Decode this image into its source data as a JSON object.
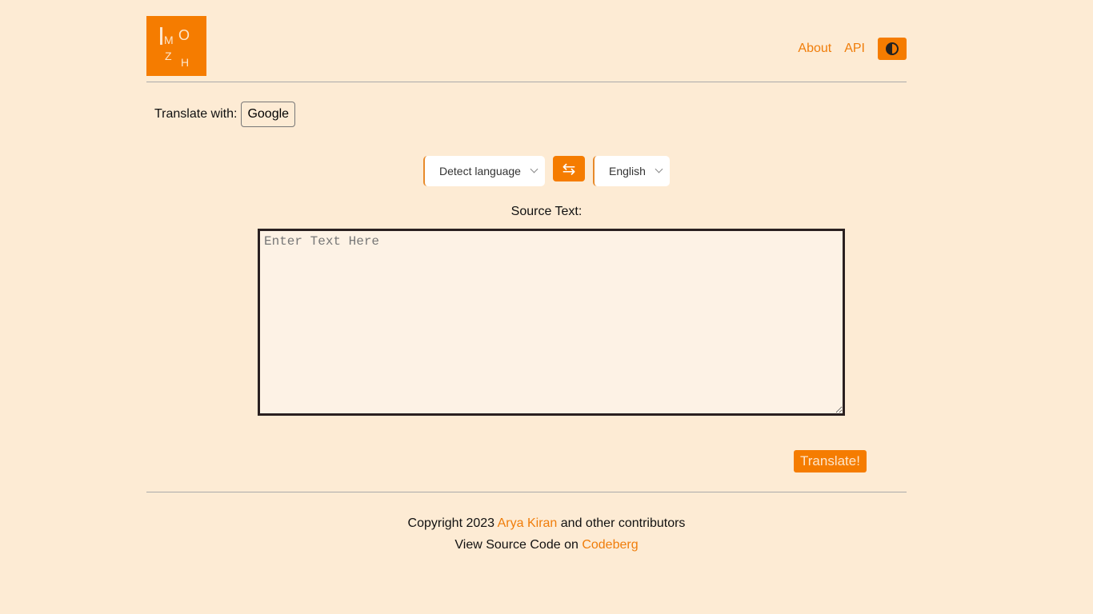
{
  "logo": {
    "letters": [
      "M",
      "O",
      "Z",
      "H"
    ]
  },
  "nav": {
    "about": "About",
    "api": "API"
  },
  "engine": {
    "label": "Translate with:",
    "value": "Google"
  },
  "source_lang": "Detect language",
  "target_lang": "English",
  "source": {
    "label": "Source Text:",
    "placeholder": "Enter Text Here"
  },
  "translate_label": "Translate!",
  "footer": {
    "copy_pre": "Copyright 2023",
    "author": "Arya Kiran",
    "copy_post": "and other contributors",
    "src_pre": "View Source Code on",
    "src_link": "Codeberg"
  },
  "colors": {
    "accent": "#f57c00",
    "background": "#fdebd4"
  }
}
